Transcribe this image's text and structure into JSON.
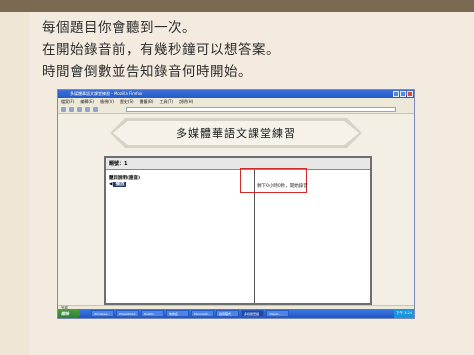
{
  "slide": {
    "bullets": [
      "每個題目你會聽到一次。",
      "在開始錄音前，有幾秒鐘可以想答案。",
      "時間會倒數並告知錄音何時開始。"
    ]
  },
  "browser": {
    "title": "多媒體華語文課堂練習 - Mozilla Firefox",
    "menu": [
      "檔案(F)",
      "編輯(E)",
      "檢視(V)",
      "歷史(S)",
      "書籤(B)",
      "工具(T)",
      "說明(H)"
    ],
    "status": "完成"
  },
  "page": {
    "banner_title": "多媒體華語文課堂練習",
    "question_label": "題號：1",
    "instruction_label": "題目說明(語音)",
    "play_label": "播放",
    "timer_text": "剩下0小時0秒，開始錄音"
  },
  "taskbar": {
    "start_label": "開始",
    "items": [
      "Windows...",
      "PowerPoint",
      "Firefox",
      "未命名",
      "Microsoft...",
      "錄音程式",
      "多媒體華語",
      "Visual..."
    ],
    "clock": "下午 3:24"
  },
  "colors": {
    "slide_bg": "#f3ebe0",
    "top_bar": "#7a6a52",
    "highlight_box": "#d62a2a",
    "titlebar": "#245bc6"
  }
}
